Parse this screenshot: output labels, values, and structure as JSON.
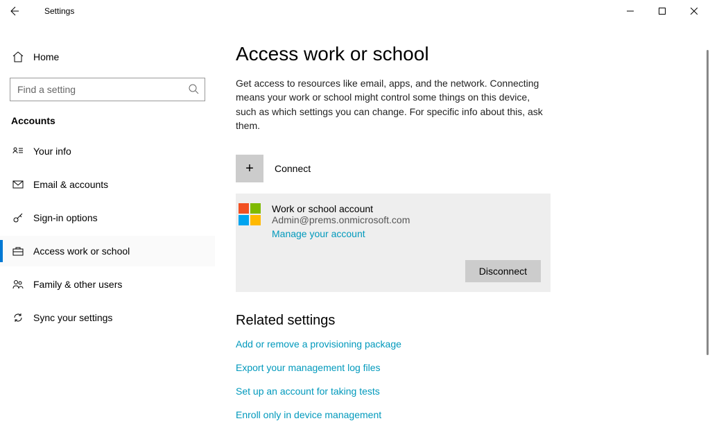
{
  "window": {
    "title": "Settings"
  },
  "sidebar": {
    "home_label": "Home",
    "search_placeholder": "Find a setting",
    "section": "Accounts",
    "items": [
      {
        "label": "Your info"
      },
      {
        "label": "Email & accounts"
      },
      {
        "label": "Sign-in options"
      },
      {
        "label": "Access work or school"
      },
      {
        "label": "Family & other users"
      },
      {
        "label": "Sync your settings"
      }
    ]
  },
  "main": {
    "heading": "Access work or school",
    "description": "Get access to resources like email, apps, and the network. Connecting means your work or school might control some things on this device, such as which settings you can change. For specific info about this, ask them.",
    "connect_label": "Connect",
    "account": {
      "title": "Work or school account",
      "email": "Admin@prems.onmicrosoft.com",
      "manage_link": "Manage your account",
      "disconnect_label": "Disconnect"
    },
    "related": {
      "heading": "Related settings",
      "links": [
        "Add or remove a provisioning package",
        "Export your management log files",
        "Set up an account for taking tests",
        "Enroll only in device management"
      ]
    }
  }
}
